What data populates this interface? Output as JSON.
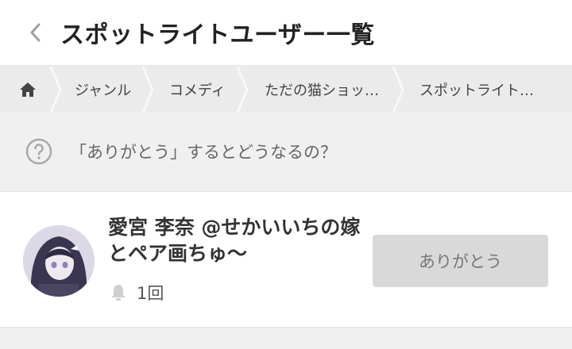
{
  "header": {
    "back_icon": "chevron-left-icon",
    "title": "スポットライトユーザー一覧"
  },
  "breadcrumb": {
    "home_icon": "home-icon",
    "items": [
      {
        "label": "ジャンル"
      },
      {
        "label": "コメディ"
      },
      {
        "label": "ただの猫ショッ…"
      },
      {
        "label": "スポットライト…"
      }
    ]
  },
  "help": {
    "icon": "question-circle-icon",
    "text": "「ありがとう」するとどうなるの？"
  },
  "users": [
    {
      "name": "愛宮 李奈 @せかいいちの嫁とペア画ちゅ〜",
      "count_icon": "bell-icon",
      "count": "1回",
      "button_label": "ありがとう"
    }
  ],
  "colors": {
    "background": "#f0f0f0",
    "header_bg": "#ffffff",
    "breadcrumb_bg": "#ebebeb",
    "button_bg": "#d9d9d9",
    "button_text": "#777777"
  }
}
